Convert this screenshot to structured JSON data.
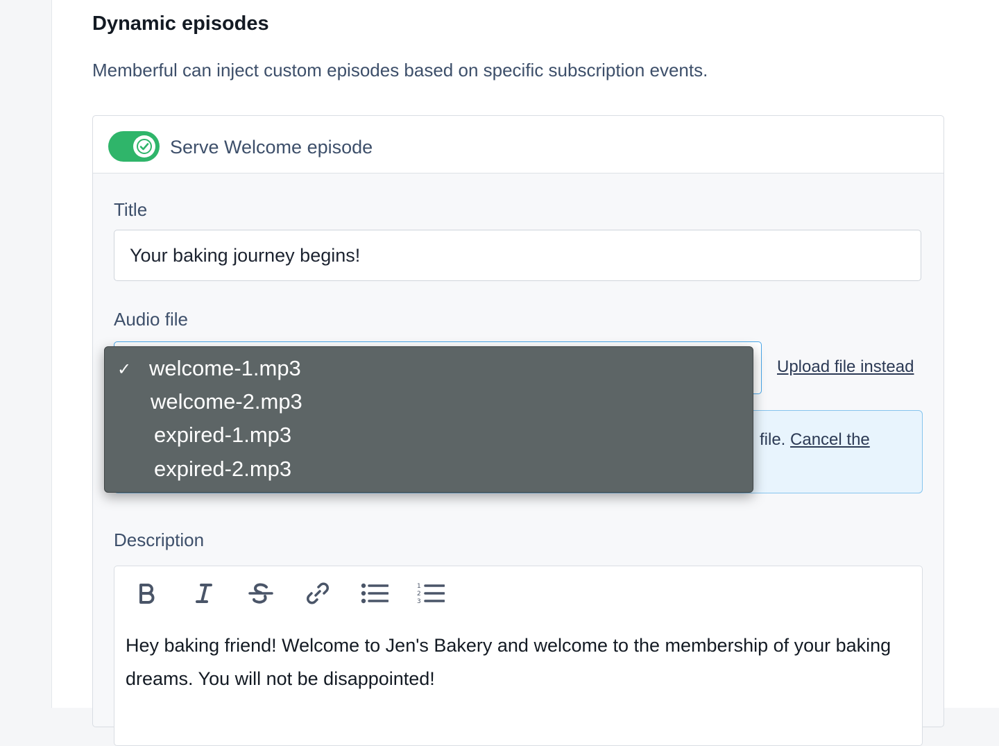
{
  "section": {
    "title": "Dynamic episodes",
    "description": "Memberful can inject custom episodes based on specific subscription events."
  },
  "welcome": {
    "toggle_label": "Serve Welcome episode",
    "toggle_on": true,
    "title_label": "Title",
    "title_value": "Your baking journey begins!",
    "audio_label": "Audio file",
    "upload_link": "Upload file instead",
    "info_text_partial": "file.",
    "info_link_partial": "Cancel the",
    "description_label": "Description",
    "description_text": "Hey baking friend! Welcome to Jen's Bakery and welcome to the membership of your baking dreams. You will not be disappointed!"
  },
  "audio_dropdown": {
    "selected": "welcome-1.mp3",
    "options": [
      {
        "label": "welcome-1.mp3",
        "selected": true
      },
      {
        "label": "welcome-2.mp3",
        "selected": false
      },
      {
        "label": "expired-1.mp3",
        "selected": false
      },
      {
        "label": "expired-2.mp3",
        "selected": false
      }
    ],
    "check_glyph": "✓"
  },
  "toolbar": {
    "buttons": [
      "bold-icon",
      "italic-icon",
      "strikethrough-icon",
      "link-icon",
      "bullet-list-icon",
      "numbered-list-icon"
    ]
  },
  "colors": {
    "toggle_on": "#2fb56a",
    "focus_border": "#48a6e8",
    "info_bg": "#e8f4fd",
    "dropdown_bg": "#5d6566"
  }
}
